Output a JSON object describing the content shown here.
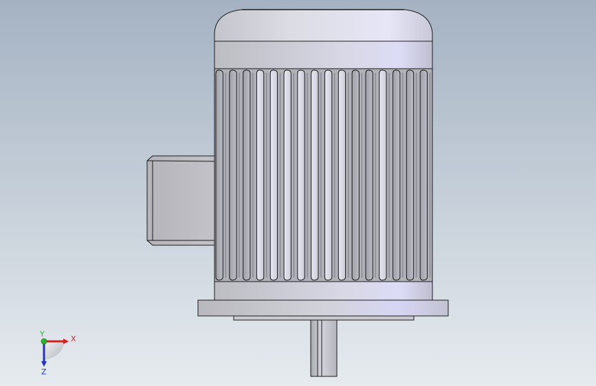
{
  "viewport": {
    "background_top": "#a4b2c2",
    "background_bottom": "#e6ebef",
    "edge_color": "#1a1a1a",
    "model": "motor"
  },
  "triad": {
    "x_label": "X",
    "y_label": "Y",
    "z_label": "Z",
    "x_color": "#d42020",
    "y_color": "#2bb52b",
    "z_color": "#2430c8"
  }
}
